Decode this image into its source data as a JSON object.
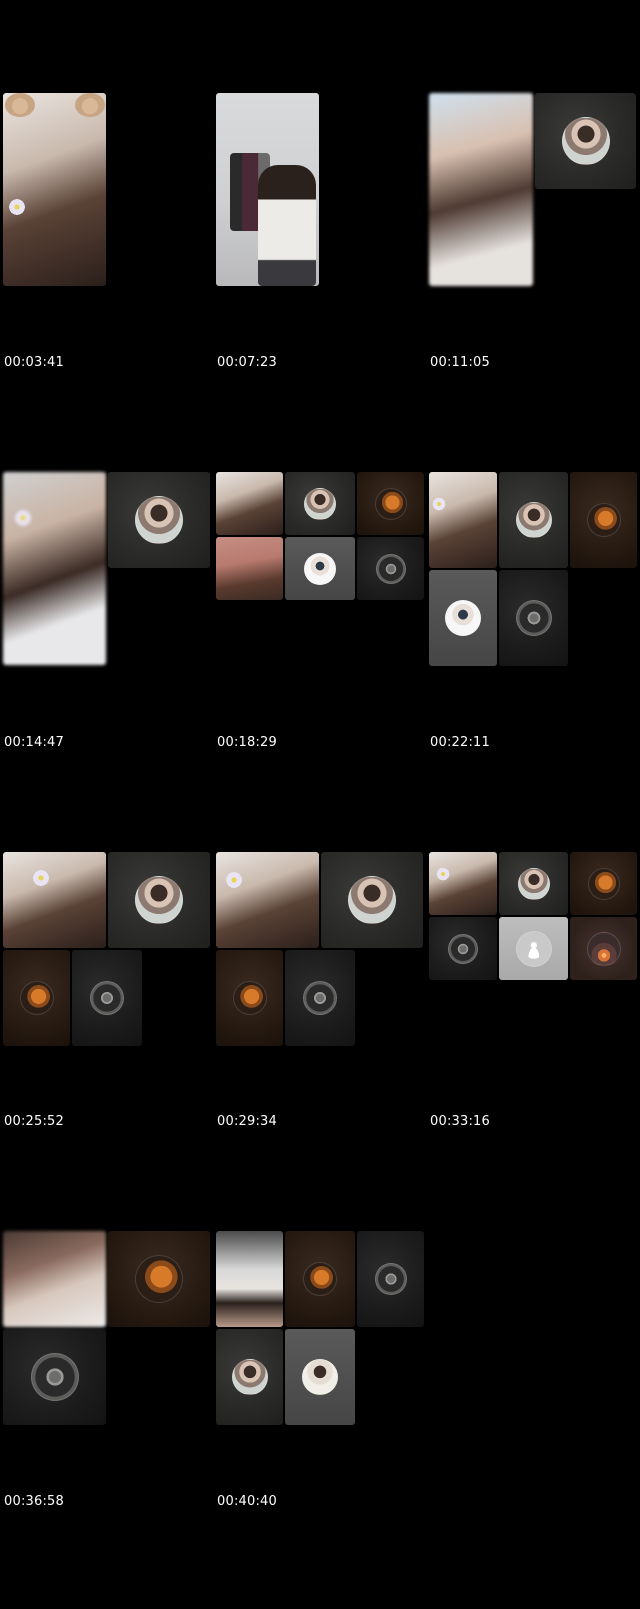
{
  "timestamps": {
    "t1": "00:03:41",
    "t2": "00:07:23",
    "t3": "00:11:05",
    "t4": "00:14:47",
    "t5": "00:18:29",
    "t6": "00:22:11",
    "t7": "00:25:52",
    "t8": "00:29:34",
    "t9": "00:33:16",
    "t10": "00:36:58",
    "t11": "00:40:40"
  },
  "colors": {
    "background": "#000000",
    "timestamp_text": "#ffffff"
  }
}
